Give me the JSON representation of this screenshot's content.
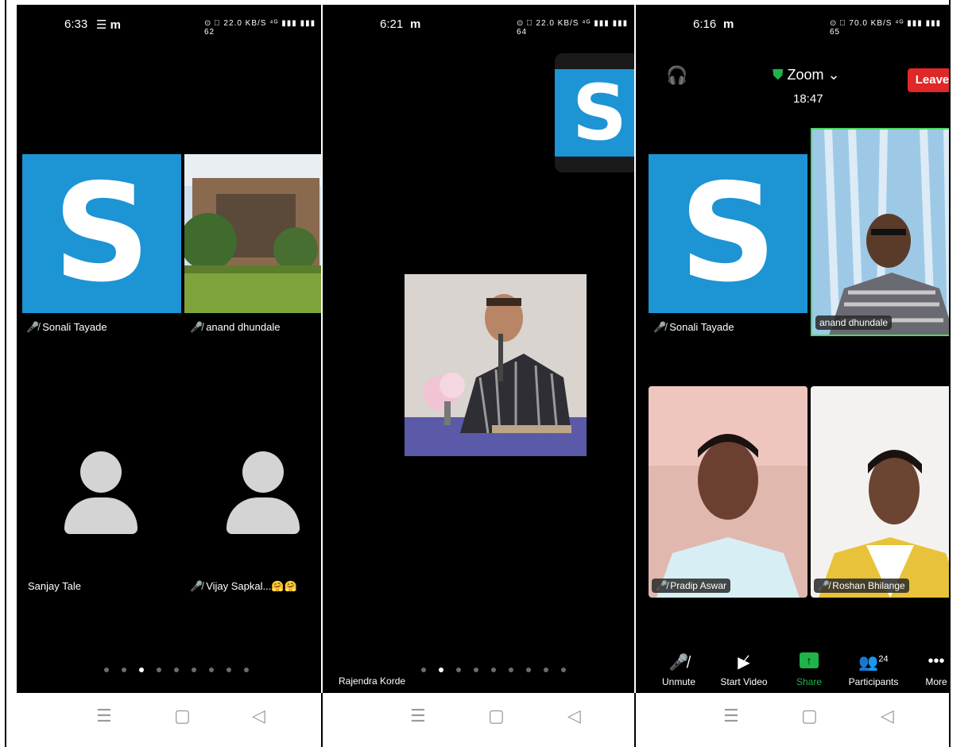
{
  "panels": [
    {
      "status": {
        "time": "6:33",
        "icons": "☰ m",
        "right": "⊙ ⃞ 22.0 KB/S  ⁴ᴳ ▮▮▮ ▮▮▮ 62"
      },
      "tiles": [
        {
          "name": "Sonali Tayade",
          "muted": true
        },
        {
          "name": "anand dhundale",
          "muted": true
        },
        {
          "name": "Sanjay Tale",
          "muted": false
        },
        {
          "name": "Vijay Sapkal...🤗🤗",
          "muted": true
        }
      ],
      "page_dots": {
        "count": 9,
        "active": 3
      }
    },
    {
      "status": {
        "time": "6:21",
        "icons": "m",
        "right": "⊙ ⃞ 22.0 KB/S  ⁴ᴳ ▮▮▮ ▮▮▮ 64"
      },
      "speaker_name": "Rajendra Korde",
      "page_dots": {
        "count": 9,
        "active": 2
      }
    },
    {
      "status": {
        "time": "6:16",
        "icons": "m",
        "right": "⊙ ⃞ 70.0 KB/S  ⁴ᴳ ▮▮▮ ▮▮▮ 65"
      },
      "header": {
        "title": "Zoom ⌄",
        "timer": "18:47",
        "leave": "Leave"
      },
      "tiles": [
        {
          "name": "Sonali Tayade",
          "muted": true
        },
        {
          "name": "anand dhundale",
          "muted": false
        },
        {
          "name": "Pradip Aswar",
          "muted": true
        },
        {
          "name": "Roshan Bhilange",
          "muted": true
        }
      ],
      "toolbar": {
        "unmute": "Unmute",
        "start_video": "Start Video",
        "share": "Share",
        "participants": "Participants",
        "participants_count": "24",
        "more": "More"
      }
    }
  ],
  "colors": {
    "zoom_blue": "#1d94d4",
    "leave_red": "#e02828",
    "share_green": "#1fb34a",
    "active_border": "#4cd964"
  }
}
